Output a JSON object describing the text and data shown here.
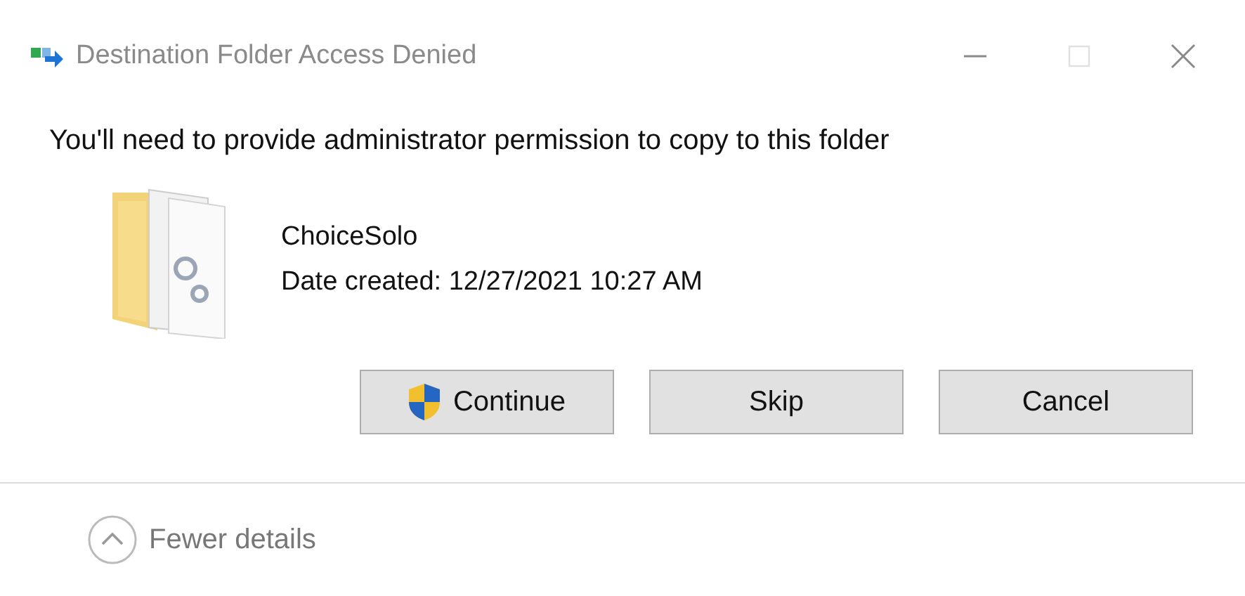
{
  "window": {
    "title": "Destination Folder Access Denied",
    "active": false
  },
  "window_controls": [
    {
      "kind": "minimize",
      "disabled": false
    },
    {
      "kind": "maximize",
      "disabled": true
    },
    {
      "kind": "close",
      "disabled": false
    }
  ],
  "message": "You'll need to provide administrator permission to copy to this folder",
  "item": {
    "name": "ChoiceSolo",
    "date": "Date created: 12/27/2021 10:27 AM"
  },
  "buttons": [
    {
      "label": "Continue",
      "kind": "shield"
    },
    {
      "label": "Skip",
      "kind": "plain"
    },
    {
      "label": "Cancel",
      "kind": "plain"
    }
  ],
  "details_toggle": {
    "label": "Fewer details",
    "expanded": true
  }
}
